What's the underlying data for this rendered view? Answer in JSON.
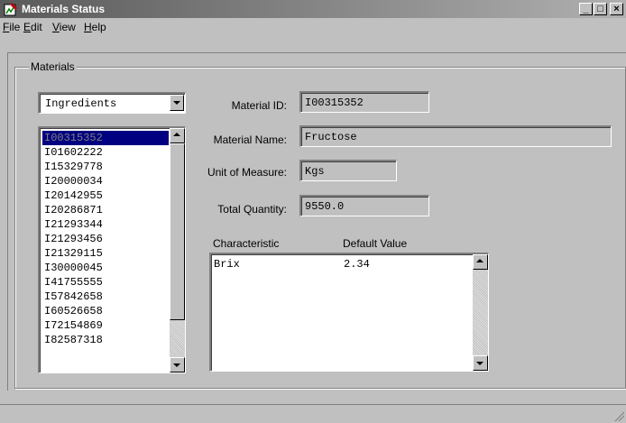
{
  "window": {
    "title": "Materials Status",
    "controls": {
      "minimize": "_",
      "maximize": "□",
      "close": "×"
    }
  },
  "menu": [
    {
      "label": "File",
      "mnemonic": "F",
      "rest": "ile"
    },
    {
      "label": "Edit",
      "mnemonic": "E",
      "rest": "dit"
    },
    {
      "label": "View",
      "mnemonic": "V",
      "rest": "iew"
    },
    {
      "label": "Help",
      "mnemonic": "H",
      "rest": "elp"
    }
  ],
  "materials_group": {
    "label": "Materials",
    "type_select": {
      "value": "Ingredients"
    },
    "list": {
      "items": [
        "I00315352",
        "I01602222",
        "I15329778",
        "I20000034",
        "I20142955",
        "I20286871",
        "I21293344",
        "I21293456",
        "I21329115",
        "I30000045",
        "I41755555",
        "I57842658",
        "I60526658",
        "I72154869",
        "I82587318"
      ],
      "selected_index": 0
    },
    "fields": {
      "material_id": {
        "label": "Material ID:",
        "value": "I00315352"
      },
      "material_name": {
        "label": "Material Name:",
        "value": "Fructose"
      },
      "unit_of_measure": {
        "label": "Unit of Measure:",
        "value": "Kgs"
      },
      "total_quantity": {
        "label": "Total Quantity:",
        "value": "9550.0"
      }
    },
    "characteristics": {
      "columns": [
        "Characteristic",
        "Default Value"
      ],
      "rows": [
        {
          "characteristic": "Brix",
          "default_value": "2.34"
        }
      ]
    }
  }
}
